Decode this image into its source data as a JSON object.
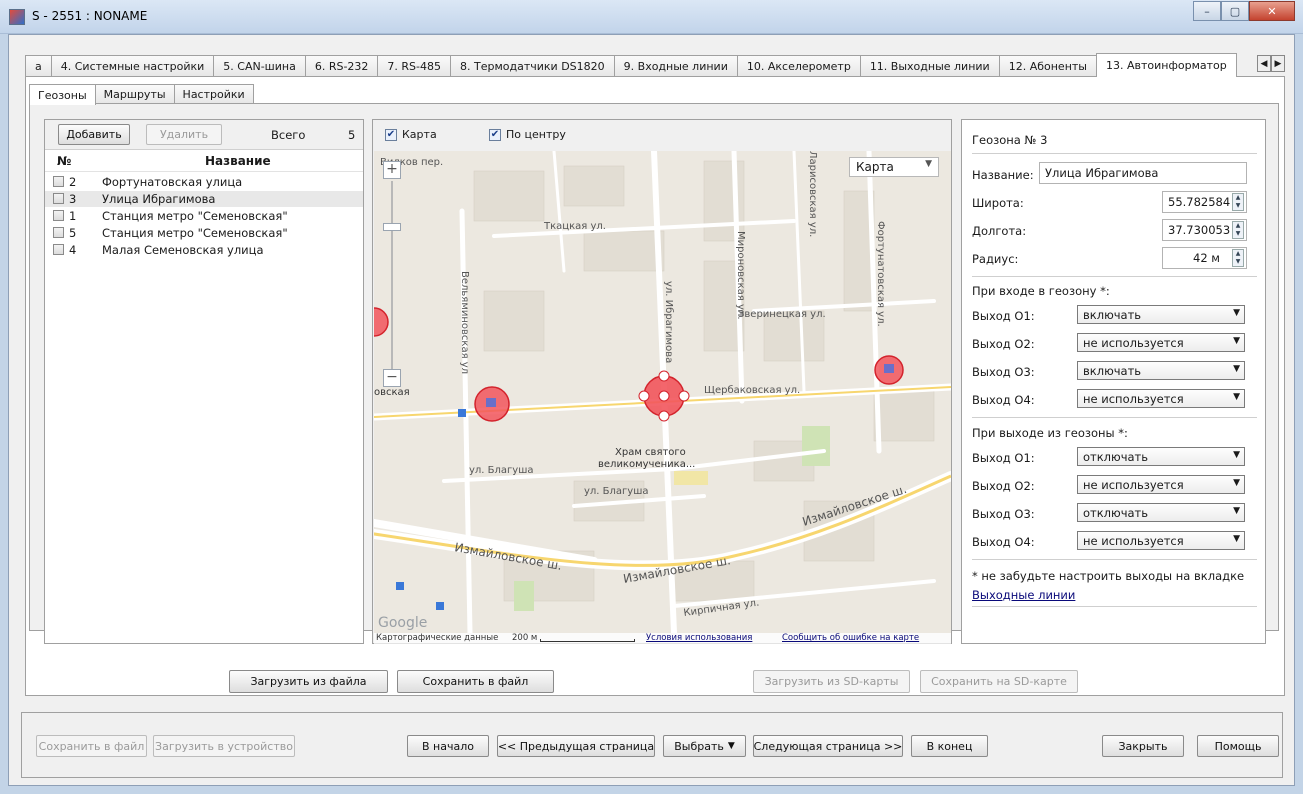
{
  "window": {
    "title": "S - 2551 : NONAME",
    "buttons": [
      "–",
      "▢",
      "✕"
    ]
  },
  "tabs": {
    "items": [
      "а",
      "4. Системные настройки",
      "5. CAN-шина",
      "6. RS-232",
      "7. RS-485",
      "8. Термодатчики DS1820",
      "9. Входные линии",
      "10. Акселерометр",
      "11. Выходные линии",
      "12. Абоненты",
      "13. Автоинформатор"
    ],
    "active_index": 10,
    "scroll_left": "◀",
    "scroll_right": "▶"
  },
  "subtabs": {
    "items": [
      "Геозоны",
      "Маршруты",
      "Настройки"
    ],
    "active_index": 0
  },
  "geozone_list": {
    "add_label": "Добавить",
    "delete_label": "Удалить",
    "total_label": "Всего",
    "total_count": "5",
    "col_number": "№",
    "col_name": "Название",
    "rows": [
      {
        "no": "2",
        "name": "Фортунатовская улица"
      },
      {
        "no": "3",
        "name": "Улица Ибрагимова"
      },
      {
        "no": "1",
        "name": "Станция метро \"Семеновская\""
      },
      {
        "no": "5",
        "name": "Станция метро \"Семеновская\""
      },
      {
        "no": "4",
        "name": "Малая Семеновская улица"
      }
    ],
    "selected_index": 1
  },
  "map": {
    "check_map_label": "Карта",
    "check_center_label": "По центру",
    "check_glyph": "✔",
    "type_select": "Карта",
    "zoom_in": "+",
    "zoom_out": "−",
    "footer_data": "Картографические данные",
    "footer_scale": "200 м",
    "footer_terms": "Условия использования",
    "footer_report": "Сообщить об ошибке на карте",
    "google_logo": "Google",
    "labels": {
      "vilkov": "Вилков пер.",
      "tkatskaya": "Ткацкая ул.",
      "vilkovskaya": "Вельяминовская ул",
      "ibragimova": "ул. Ибрагимова",
      "mironovskaya": "Мироновская ул.",
      "zverinetskaya": "Зверинецкая ул.",
      "fortunatovskaya": "Фортунатовская ул.",
      "larisovskaya": "Ларисовская ул.",
      "shcherbakovskaya": "Щербаковская ул.",
      "khram": "Храм святого",
      "khram2": "великомученика...",
      "blagusha1": "ул. Благуша",
      "blagusha2": "ул. Благуша",
      "izmaylovskoe1": "Измайловское ш.",
      "izmaylovskoe2": "Измайловское ш.",
      "izmaylovskoe3": "Измайловское ш.",
      "kirpichnaya": "Кирпичная ул.",
      "left_edge": "овская"
    }
  },
  "geozone_form": {
    "header": "Геозона № 3",
    "name_label": "Название:",
    "name_value": "Улица Ибрагимова",
    "lat_label": "Широта:",
    "lat_value": "55.782584",
    "lon_label": "Долгота:",
    "lon_value": "37.730053",
    "radius_label": "Радиус:",
    "radius_value": "42 м",
    "on_enter_label": "При входе в геозону *:",
    "on_exit_label": "При выходе из геозоны *:",
    "enter_outputs": [
      {
        "label": "Выход О1:",
        "value": "включать"
      },
      {
        "label": "Выход О2:",
        "value": "не используется"
      },
      {
        "label": "Выход О3:",
        "value": "включать"
      },
      {
        "label": "Выход О4:",
        "value": "не используется"
      }
    ],
    "exit_outputs": [
      {
        "label": "Выход О1:",
        "value": "отключать"
      },
      {
        "label": "Выход О2:",
        "value": "не используется"
      },
      {
        "label": "Выход О3:",
        "value": "отключать"
      },
      {
        "label": "Выход О4:",
        "value": "не используется"
      }
    ],
    "note": "* не забудьте настроить выходы на вкладке",
    "note_link": "Выходные линии"
  },
  "file_buttons": {
    "load_file": "Загрузить из файла",
    "save_file": "Сохранить в файл",
    "load_sd": "Загрузить из SD-карты",
    "save_sd": "Сохранить на SD-карте"
  },
  "footer": {
    "save_file": "Сохранить в файл",
    "load_device": "Загрузить в устройство",
    "first": "В начало",
    "prev": "<< Предыдущая страница",
    "select": "Выбрать",
    "next": "Следующая страница >>",
    "last": "В конец",
    "close": "Закрыть",
    "help": "Помощь"
  },
  "colors": {
    "geozone_fill": "#f2555c",
    "geozone_stroke": "#d3232c",
    "map_bg": "#ece8e0",
    "road": "#ffffff",
    "park": "#cfe3b5",
    "water": "#aac8e8"
  }
}
